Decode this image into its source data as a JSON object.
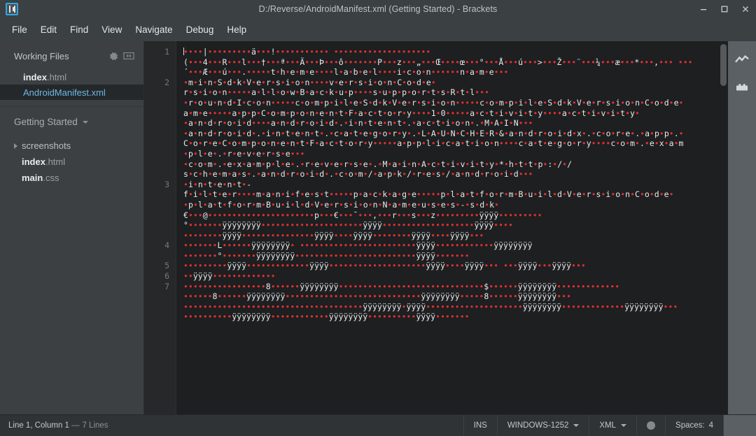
{
  "window": {
    "title": "D:/Reverse/AndroidManifest.xml (Getting Started) - Brackets",
    "logo_icon": "brackets-logo-icon",
    "minimize_icon": "minimize-icon",
    "maximize_icon": "maximize-icon",
    "close_icon": "close-icon",
    "accent_color": "#2ea8e5",
    "titlebar_bg": "#3b4043"
  },
  "menubar": {
    "items": [
      {
        "label": "File"
      },
      {
        "label": "Edit"
      },
      {
        "label": "Find"
      },
      {
        "label": "View"
      },
      {
        "label": "Navigate"
      },
      {
        "label": "Debug"
      },
      {
        "label": "Help"
      }
    ]
  },
  "sidebar": {
    "working_files": {
      "title": "Working Files",
      "gear_icon": "gear-icon",
      "split_icon": "split-view-icon",
      "files": [
        {
          "name": "index",
          "ext": ".html",
          "selected": false
        },
        {
          "name": "AndroidManifest",
          "ext": ".xml",
          "selected": true
        }
      ]
    },
    "project": {
      "name": "Getting Started",
      "caret_icon": "chevron-down-icon",
      "tree": [
        {
          "type": "folder",
          "label": "screenshots",
          "arrow_icon": "chevron-right-icon"
        },
        {
          "type": "file",
          "name": "index",
          "ext": ".html"
        },
        {
          "type": "file",
          "name": "main",
          "ext": ".css"
        }
      ]
    }
  },
  "editor": {
    "line_numbers": [
      "1",
      "2",
      "3",
      "4",
      "5",
      "6",
      "7"
    ],
    "selected_file_color": "#6bb8e8",
    "dot_color": "#e03030",
    "background": "#1d1f21",
    "lines": [
      {
        "num": "1",
        "cursor": true,
        "segs": [
          {
            "d": 4
          },
          {
            "t": "|"
          },
          {
            "d": 9
          },
          {
            "t": "ä"
          },
          {
            "d": 3
          },
          {
            "t": "!"
          },
          {
            "d": 11
          },
          {
            "t": " "
          },
          {
            "d": 20
          }
        ]
      },
      {
        "num": "",
        "segs": [
          {
            "t": "("
          },
          {
            "d": 3
          },
          {
            "t": "4"
          },
          {
            "d": 3
          },
          {
            "t": "R"
          },
          {
            "d": 3
          },
          {
            "t": "l"
          },
          {
            "d": 3
          },
          {
            "t": "†"
          },
          {
            "d": 3
          },
          {
            "t": "ª"
          },
          {
            "d": 3
          },
          {
            "t": "Ä"
          },
          {
            "d": 3
          },
          {
            "t": "Þ"
          },
          {
            "d": 3
          },
          {
            "t": "ô"
          },
          {
            "d": 7
          },
          {
            "t": "P"
          },
          {
            "d": 3
          },
          {
            "t": "z"
          },
          {
            "d": 3
          },
          {
            "t": "„"
          },
          {
            "d": 3
          },
          {
            "t": "Œ"
          },
          {
            "d": 4
          },
          {
            "t": "œ"
          },
          {
            "d": 3
          },
          {
            "t": "°"
          },
          {
            "d": 3
          },
          {
            "t": "Å"
          },
          {
            "d": 3
          },
          {
            "t": "ú"
          },
          {
            "d": 3
          },
          {
            "t": ">"
          },
          {
            "d": 3
          },
          {
            "t": "Ž"
          },
          {
            "d": 3
          },
          {
            "t": "¨"
          },
          {
            "d": 3
          },
          {
            "t": "¼"
          },
          {
            "d": 3
          },
          {
            "t": "æ"
          },
          {
            "d": 3
          },
          {
            "t": "*"
          },
          {
            "d": 3
          },
          {
            "t": ","
          },
          {
            "d": 3
          },
          {
            "t": " "
          },
          {
            "d": 3
          }
        ]
      },
      {
        "num": "",
        "segs": [
          {
            "t": "´"
          },
          {
            "d": 3
          },
          {
            "t": "Æ"
          },
          {
            "d": 3
          },
          {
            "t": "ú"
          },
          {
            "d": 3
          },
          {
            "t": "."
          },
          {
            "d": 5
          },
          {
            "t": "t·h·e·m·e"
          },
          {
            "d": 4
          },
          {
            "t": "l·a·b·e·l"
          },
          {
            "d": 4
          },
          {
            "t": "i·c·o·n"
          },
          {
            "d": 6
          },
          {
            "t": "n·a·m·e"
          },
          {
            "d": 3
          }
        ]
      },
      {
        "num": "2",
        "segs": [
          {
            "d": 1
          },
          {
            "t": "m·i·n·S·d·k·V·e·r·s·i·o·n"
          },
          {
            "d": 4
          },
          {
            "t": "v·e·r·s·i·o·n·C·o·d·e"
          },
          {
            "d": 1
          }
        ]
      },
      {
        "num": "",
        "segs": [
          {
            "t": "r·s·i·o·n"
          },
          {
            "d": 5
          },
          {
            "t": "a·l·l·o·w·B·a·c·k·u·p"
          },
          {
            "d": 4
          },
          {
            "t": "s·u·p·p·o·r·t·s·R·t·l"
          },
          {
            "d": 3
          }
        ]
      },
      {
        "num": "",
        "segs": [
          {
            "d": 1
          },
          {
            "t": "r·o·u·n·d·I·c·o·n"
          },
          {
            "d": 5
          },
          {
            "t": "c·o·m·p·i·l·e·S·d·k·V·e·r·s·i·o·n"
          },
          {
            "d": 5
          },
          {
            "t": "c·o·m·p·i·l·e·S·d·k·V·e·r·s·i·o·n·C·o·d·e"
          },
          {
            "d": 1
          }
        ]
      },
      {
        "num": "",
        "segs": [
          {
            "t": "a·m·e"
          },
          {
            "d": 5
          },
          {
            "t": "a·p·p·C·o·m·p·o·n·e·n·t·F·a·c·t·o·r·y"
          },
          {
            "d": 4
          },
          {
            "t": "1"
          },
          {
            "d": 1
          },
          {
            "t": "0"
          },
          {
            "d": 5
          },
          {
            "t": "a·c·t·i·v·i·t·y"
          },
          {
            "d": 4
          },
          {
            "t": "a·c·t·i·v·i·t·y"
          },
          {
            "d": 1
          }
        ]
      },
      {
        "num": "",
        "segs": [
          {
            "d": 1
          },
          {
            "t": "a·n·d·r·o·i·d"
          },
          {
            "d": 4
          },
          {
            "t": "a·n·d·r·o·i·d·.·i·n·t·e·n·t·.·a·c·t·i·o·n·.·M·A·I·N"
          },
          {
            "d": 3
          }
        ]
      },
      {
        "num": "",
        "segs": [
          {
            "d": 1
          },
          {
            "t": "a·n·d·r·o·i·d·.·i·n·t·e·n·t·.·c·a·t·e·g·o·r·y·.·L·A·U·N·C·H·E·R"
          },
          {
            "d": 1
          },
          {
            "t": "&"
          },
          {
            "d": 1
          },
          {
            "t": "a·n·d·r·o·i·d·x·.·c·o·r·e·.·a·p·p·."
          },
          {
            "d": 1
          }
        ]
      },
      {
        "num": "",
        "segs": [
          {
            "t": "C·o·r·e·C·o·m·p·o·n·e·n·t·F·a·c·t·o·r·y"
          },
          {
            "d": 5
          },
          {
            "t": "a·p·p·l·i·c·a·t·i·o·n"
          },
          {
            "d": 4
          },
          {
            "t": "c·a·t·e·g·o·r·y"
          },
          {
            "d": 4
          },
          {
            "t": "c·o·m·.·e·x·a·m"
          }
        ]
      },
      {
        "num": "",
        "segs": [
          {
            "d": 1
          },
          {
            "t": "p·l·e·.·r·e·v·e·r·s·e"
          },
          {
            "d": 3
          }
        ]
      },
      {
        "num": "",
        "segs": [
          {
            "d": 1
          },
          {
            "t": "c·o·m·.·e·x·a·m·p·l·e·.·r·e·v·e·r·s·e·.·M·a·i·n·A·c·t·i·v·i·t·y"
          },
          {
            "d": 1
          },
          {
            "t": "*"
          },
          {
            "d": 1
          },
          {
            "t": "h·t·t·p·:·/·/"
          }
        ]
      },
      {
        "num": "",
        "segs": [
          {
            "t": "s·c·h·e·m·a·s·.·a·n·d·r·o·i·d·.·c·o·m·/·a·p·k·/·r·e·s·/·a·n·d·r·o·i·d"
          },
          {
            "d": 3
          }
        ]
      },
      {
        "num": "3",
        "segs": [
          {
            "d": 1
          },
          {
            "t": "i·n·t·e·n·t·-"
          }
        ]
      },
      {
        "num": "",
        "segs": [
          {
            "t": "f·i·l·t·e·r"
          },
          {
            "d": 4
          },
          {
            "t": "m·a·n·i·f·e·s·t"
          },
          {
            "d": 5
          },
          {
            "t": "p·a·c·k·a·g·e"
          },
          {
            "d": 5
          },
          {
            "t": "p·l·a·t·f·o·r·m·B·u·i·l·d·V·e·r·s·i·o·n·C·o·d·e"
          },
          {
            "d": 1
          }
        ]
      },
      {
        "num": "",
        "segs": [
          {
            "d": 1
          },
          {
            "t": "p·l·a·t·f·o·r·m·B·u·i·l·d·V·e·r·s·i·o·n·N·a·m·e"
          },
          {
            "d": 1
          },
          {
            "t": "u·s·e·s·-·s·d·k"
          },
          {
            "d": 1
          }
        ]
      },
      {
        "num": "",
        "segs": [
          {
            "t": "€"
          },
          {
            "d": 3
          },
          {
            "t": "@"
          },
          {
            "d": 22
          },
          {
            "t": "p"
          },
          {
            "d": 3
          },
          {
            "t": "€"
          },
          {
            "d": 3
          },
          {
            "t": "¯"
          },
          {
            "d": 3
          },
          {
            "t": ","
          },
          {
            "d": 3
          },
          {
            "t": "r"
          },
          {
            "d": 3
          },
          {
            "t": "s"
          },
          {
            "d": 3
          },
          {
            "t": "z"
          },
          {
            "d": 9
          },
          {
            "t": "ÿÿÿÿ"
          },
          {
            "d": 9
          }
        ]
      },
      {
        "num": "",
        "segs": [
          {
            "t": "°"
          },
          {
            "d": 7
          },
          {
            "t": "ÿÿÿÿÿÿÿÿ"
          },
          {
            "d": 21
          },
          {
            "t": "ÿÿÿÿ"
          },
          {
            "d": 19
          },
          {
            "t": "ÿÿÿÿ"
          },
          {
            "d": 4
          }
        ]
      },
      {
        "num": "",
        "segs": [
          {
            "d": 8
          },
          {
            "t": "ÿÿÿÿ"
          },
          {
            "d": 15
          },
          {
            "t": "ÿÿÿÿ"
          },
          {
            "d": 4
          },
          {
            "t": "ÿÿÿÿ"
          },
          {
            "d": 8
          },
          {
            "t": "ÿÿÿÿ"
          },
          {
            "d": 4
          },
          {
            "t": "ÿÿÿÿ"
          },
          {
            "d": 3
          }
        ]
      },
      {
        "num": "4",
        "segs": [
          {
            "d": 7
          },
          {
            "t": "L"
          },
          {
            "d": 6
          },
          {
            "t": "ÿÿÿÿÿÿÿÿ"
          },
          {
            "d": 1
          },
          {
            "t": " "
          },
          {
            "d": 24
          },
          {
            "t": "ÿÿÿÿ"
          },
          {
            "d": 12
          },
          {
            "t": "ÿÿÿÿÿÿÿÿ"
          }
        ]
      },
      {
        "num": "",
        "segs": [
          {
            "d": 7
          },
          {
            "t": "°"
          },
          {
            "d": 7
          },
          {
            "t": "ÿÿÿÿÿÿÿÿ"
          },
          {
            "d": 25
          },
          {
            "t": "ÿÿÿÿ"
          },
          {
            "d": 7
          }
        ]
      },
      {
        "num": "5",
        "segs": [
          {
            "d": 9
          },
          {
            "t": "ÿÿÿÿ"
          },
          {
            "d": 13
          },
          {
            "t": "ÿÿÿÿ"
          },
          {
            "d": 20
          },
          {
            "t": "ÿÿÿÿ"
          },
          {
            "d": 4
          },
          {
            "t": "ÿÿÿÿ"
          },
          {
            "d": 3
          },
          {
            "t": " "
          },
          {
            "d": 3
          },
          {
            "t": "ÿÿÿÿ"
          },
          {
            "d": 3
          },
          {
            "t": "ÿÿÿÿ"
          },
          {
            "d": 3
          }
        ]
      },
      {
        "num": "6",
        "segs": [
          {
            "d": 2
          },
          {
            "t": "ÿÿÿÿ"
          },
          {
            "d": 13
          }
        ]
      },
      {
        "num": "7",
        "segs": [
          {
            "d": 17
          },
          {
            "t": "8"
          },
          {
            "d": 6
          },
          {
            "t": "ÿÿÿÿÿÿÿÿ"
          },
          {
            "d": 30
          },
          {
            "t": "$"
          },
          {
            "d": 6
          },
          {
            "t": "ÿÿÿÿÿÿÿÿ"
          },
          {
            "d": 13
          }
        ]
      },
      {
        "num": "",
        "segs": [
          {
            "d": 6
          },
          {
            "t": "8"
          },
          {
            "d": 6
          },
          {
            "t": "ÿÿÿÿÿÿÿÿ"
          },
          {
            "d": 28
          },
          {
            "t": "ÿÿÿÿÿÿÿÿ"
          },
          {
            "d": 5
          },
          {
            "t": "8"
          },
          {
            "d": 6
          },
          {
            "t": "ÿÿÿÿÿÿÿÿ"
          },
          {
            "d": 3
          }
        ]
      },
      {
        "num": "",
        "segs": [
          {
            "d": 37
          },
          {
            "t": "ÿÿÿÿÿÿÿÿ"
          },
          {
            "d": 1
          },
          {
            "t": "ÿÿÿÿ"
          },
          {
            "d": 20
          },
          {
            "t": "ÿÿÿÿÿÿÿÿ"
          },
          {
            "d": 13
          },
          {
            "t": "ÿÿÿÿÿÿÿÿ"
          },
          {
            "d": 3
          }
        ]
      },
      {
        "num": "",
        "segs": [
          {
            "d": 10
          },
          {
            "t": "ÿÿÿÿÿÿÿÿ"
          },
          {
            "d": 12
          },
          {
            "t": "ÿÿÿÿÿÿÿÿ"
          },
          {
            "d": 10
          },
          {
            "t": "ÿÿÿÿ"
          },
          {
            "d": 7
          }
        ]
      }
    ]
  },
  "right_toolbar": {
    "buttons": [
      {
        "icon": "live-preview-icon",
        "label": "Live Preview"
      },
      {
        "icon": "extension-manager-icon",
        "label": "Extension Manager"
      }
    ]
  },
  "statusbar": {
    "cursor_info": "Line 1, Column 1",
    "separator": "—",
    "line_count": "7 Lines",
    "insert_mode": "INS",
    "encoding": "WINDOWS-1252",
    "language": "XML",
    "indicator_icon": "status-dot-icon",
    "indent": "Spaces:",
    "indent_size": "4"
  }
}
